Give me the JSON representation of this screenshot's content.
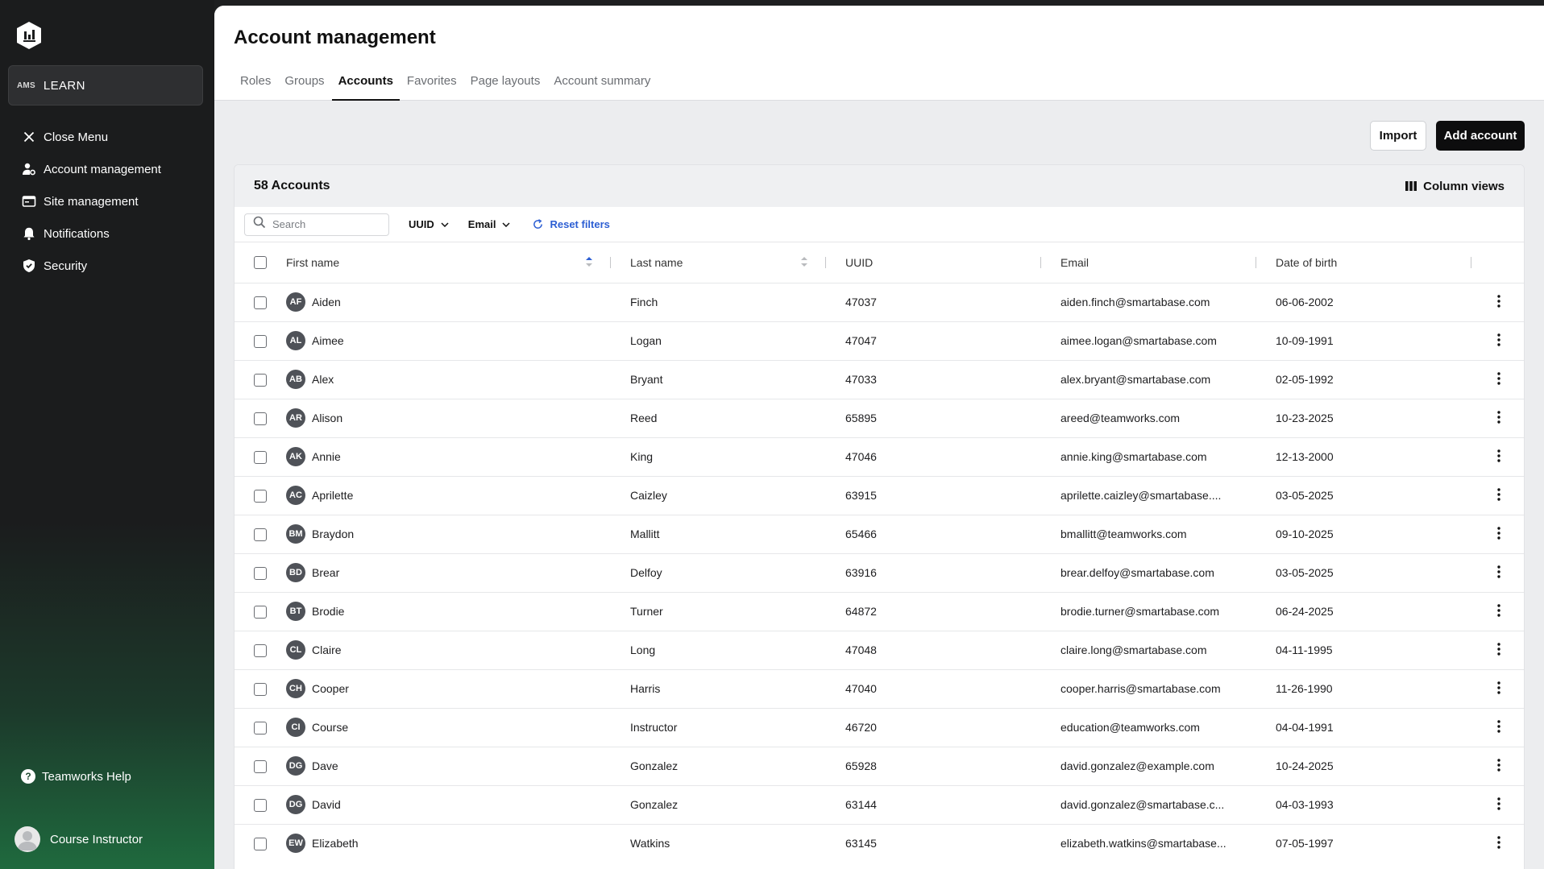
{
  "sidebar": {
    "app_badge": "AMS",
    "app_name": "LEARN",
    "items": [
      {
        "label": "Close Menu",
        "icon": "close-icon"
      },
      {
        "label": "Account management",
        "icon": "user-gear-icon"
      },
      {
        "label": "Site management",
        "icon": "browser-window-icon"
      },
      {
        "label": "Notifications",
        "icon": "bell-icon"
      },
      {
        "label": "Security",
        "icon": "shield-icon"
      }
    ],
    "help_label": "Teamworks Help",
    "user_name": "Course Instructor"
  },
  "header": {
    "title": "Account management",
    "tabs": [
      "Roles",
      "Groups",
      "Accounts",
      "Favorites",
      "Page layouts",
      "Account summary"
    ],
    "active_tab": "Accounts"
  },
  "actions": {
    "import_label": "Import",
    "add_label": "Add account"
  },
  "card": {
    "count_label": "58 Accounts",
    "column_views_label": "Column views"
  },
  "filters": {
    "search_placeholder": "Search",
    "uuid_label": "UUID",
    "email_label": "Email",
    "reset_label": "Reset filters"
  },
  "table": {
    "columns": [
      "First name",
      "Last name",
      "UUID",
      "Email",
      "Date of birth"
    ],
    "rows": [
      {
        "initials": "AF",
        "first": "Aiden",
        "last": "Finch",
        "uuid": "47037",
        "email": "aiden.finch@smartabase.com",
        "dob": "06-06-2002"
      },
      {
        "initials": "AL",
        "first": "Aimee",
        "last": "Logan",
        "uuid": "47047",
        "email": "aimee.logan@smartabase.com",
        "dob": "10-09-1991"
      },
      {
        "initials": "AB",
        "first": "Alex",
        "last": "Bryant",
        "uuid": "47033",
        "email": "alex.bryant@smartabase.com",
        "dob": "02-05-1992"
      },
      {
        "initials": "AR",
        "first": "Alison",
        "last": "Reed",
        "uuid": "65895",
        "email": "areed@teamworks.com",
        "dob": "10-23-2025"
      },
      {
        "initials": "AK",
        "first": "Annie",
        "last": "King",
        "uuid": "47046",
        "email": "annie.king@smartabase.com",
        "dob": "12-13-2000"
      },
      {
        "initials": "AC",
        "first": "Aprilette",
        "last": "Caizley",
        "uuid": "63915",
        "email": "aprilette.caizley@smartabase....",
        "dob": "03-05-2025"
      },
      {
        "initials": "BM",
        "first": "Braydon",
        "last": "Mallitt",
        "uuid": "65466",
        "email": "bmallitt@teamworks.com",
        "dob": "09-10-2025"
      },
      {
        "initials": "BD",
        "first": "Brear",
        "last": "Delfoy",
        "uuid": "63916",
        "email": "brear.delfoy@smartabase.com",
        "dob": "03-05-2025"
      },
      {
        "initials": "BT",
        "first": "Brodie",
        "last": "Turner",
        "uuid": "64872",
        "email": "brodie.turner@smartabase.com",
        "dob": "06-24-2025"
      },
      {
        "initials": "CL",
        "first": "Claire",
        "last": "Long",
        "uuid": "47048",
        "email": "claire.long@smartabase.com",
        "dob": "04-11-1995"
      },
      {
        "initials": "CH",
        "first": "Cooper",
        "last": "Harris",
        "uuid": "47040",
        "email": "cooper.harris@smartabase.com",
        "dob": "11-26-1990"
      },
      {
        "initials": "CI",
        "first": "Course",
        "last": "Instructor",
        "uuid": "46720",
        "email": "education@teamworks.com",
        "dob": "04-04-1991"
      },
      {
        "initials": "DG",
        "first": "Dave",
        "last": "Gonzalez",
        "uuid": "65928",
        "email": "david.gonzalez@example.com",
        "dob": "10-24-2025"
      },
      {
        "initials": "DG",
        "first": "David",
        "last": "Gonzalez",
        "uuid": "63144",
        "email": "david.gonzalez@smartabase.c...",
        "dob": "04-03-1993"
      },
      {
        "initials": "EW",
        "first": "Elizabeth",
        "last": "Watkins",
        "uuid": "63145",
        "email": "elizabeth.watkins@smartabase...",
        "dob": "07-05-1997"
      }
    ]
  },
  "colors": {
    "accent_link": "#2d5fd3",
    "primary_button": "#0d0d0e",
    "avatar_bg": "#4f5258"
  }
}
